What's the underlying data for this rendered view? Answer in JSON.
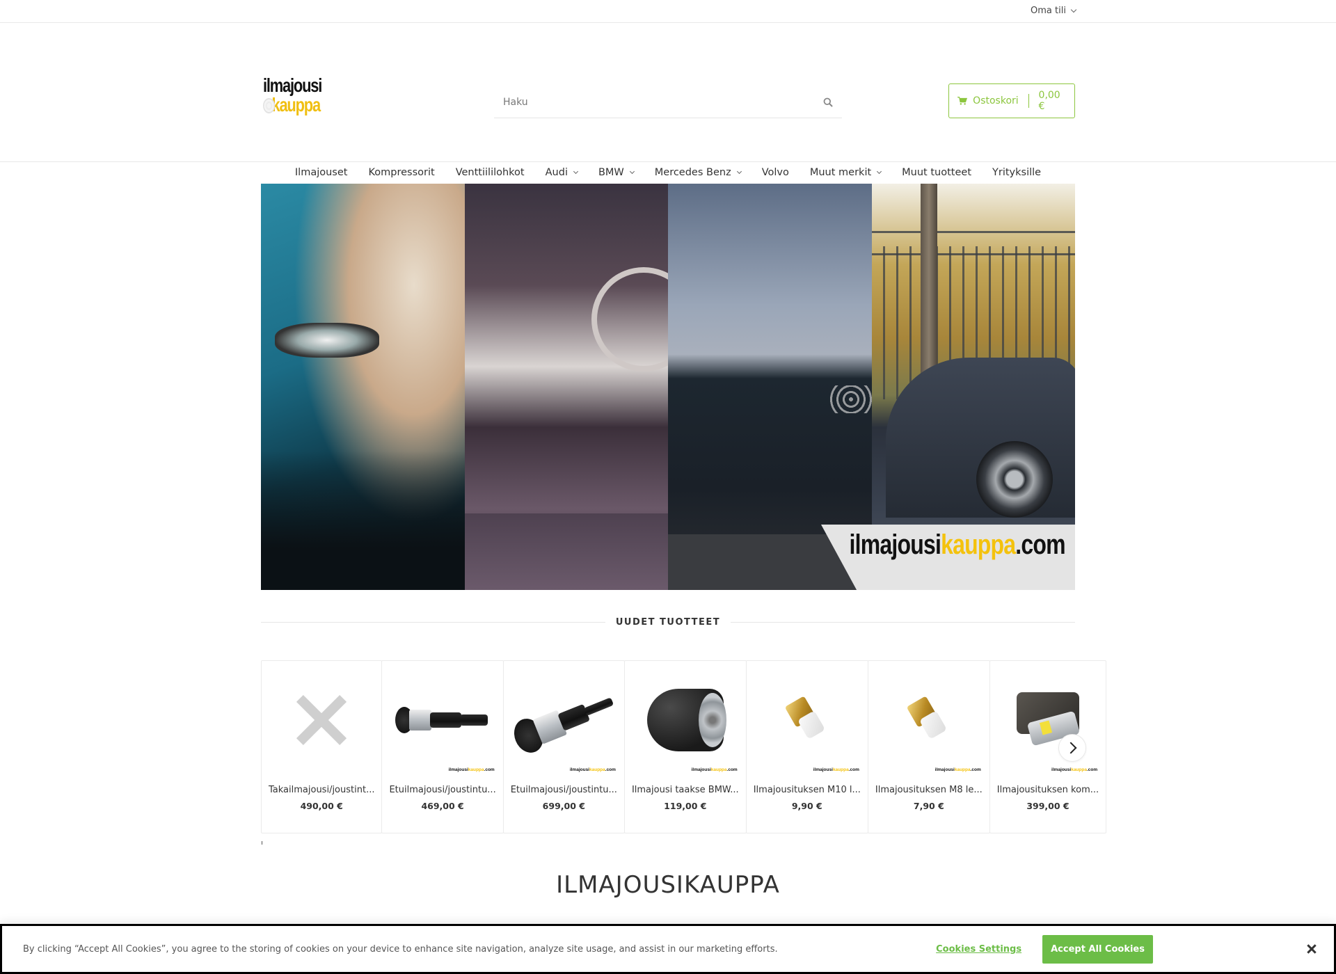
{
  "topbar": {
    "account_label": "Oma tili"
  },
  "header": {
    "logo_line1": "ilmajousi",
    "logo_line2": "kauppa",
    "search_placeholder": "Haku",
    "cart_label": "Ostoskori",
    "cart_total": "0,00 €"
  },
  "nav": {
    "items": [
      {
        "label": "Ilmajouset",
        "has_dropdown": false
      },
      {
        "label": "Kompressorit",
        "has_dropdown": false
      },
      {
        "label": "Venttiililohkot",
        "has_dropdown": false
      },
      {
        "label": "Audi",
        "has_dropdown": true
      },
      {
        "label": "BMW",
        "has_dropdown": true
      },
      {
        "label": "Mercedes Benz",
        "has_dropdown": true
      },
      {
        "label": "Volvo",
        "has_dropdown": false
      },
      {
        "label": "Muut merkit",
        "has_dropdown": true
      },
      {
        "label": "Muut tuotteet",
        "has_dropdown": false
      },
      {
        "label": "Yrityksille",
        "has_dropdown": false
      }
    ]
  },
  "banner": {
    "brand_black": "ilmajousi",
    "brand_yellow": "kauppa",
    "brand_suffix": ".com",
    "panels": [
      "bmw",
      "mercedes-benz",
      "audi",
      "volvo"
    ]
  },
  "new_products": {
    "title": "UUDET TUOTTEET",
    "watermark_black": "ilmajousi",
    "watermark_yellow": "kauppa",
    "watermark_suffix": ".com",
    "items": [
      {
        "name": "Takailmajousi/joustint...",
        "price": "490,00 €",
        "image": "placeholder-x"
      },
      {
        "name": "Etuilmajousi/joustintu...",
        "price": "469,00 €",
        "image": "air-strut-straight"
      },
      {
        "name": "Etuilmajousi/joustintu...",
        "price": "699,00 €",
        "image": "air-strut-angled"
      },
      {
        "name": "Ilmajousi taakse BMW...",
        "price": "119,00 €",
        "image": "air-bellows"
      },
      {
        "name": "Ilmajousituksen M10 l...",
        "price": "9,90 €",
        "image": "brass-fitting"
      },
      {
        "name": "Ilmajousituksen M8 le...",
        "price": "7,90 €",
        "image": "brass-fitting"
      },
      {
        "name": "Ilmajousituksen kom...",
        "price": "399,00 €",
        "image": "compressor"
      }
    ]
  },
  "main_heading": "ILMAJOUSIKAUPPA",
  "cookie_banner": {
    "message": "By clicking “Accept All Cookies”, you agree to the storing of cookies on your device to enhance site navigation, analyze site usage, and assist in our marketing efforts.",
    "settings_label": "Cookies Settings",
    "accept_label": "Accept All Cookies"
  },
  "colors": {
    "accent_green": "#8cc63e",
    "cookie_green": "#6cbd47",
    "brand_yellow": "#f4c20d"
  }
}
